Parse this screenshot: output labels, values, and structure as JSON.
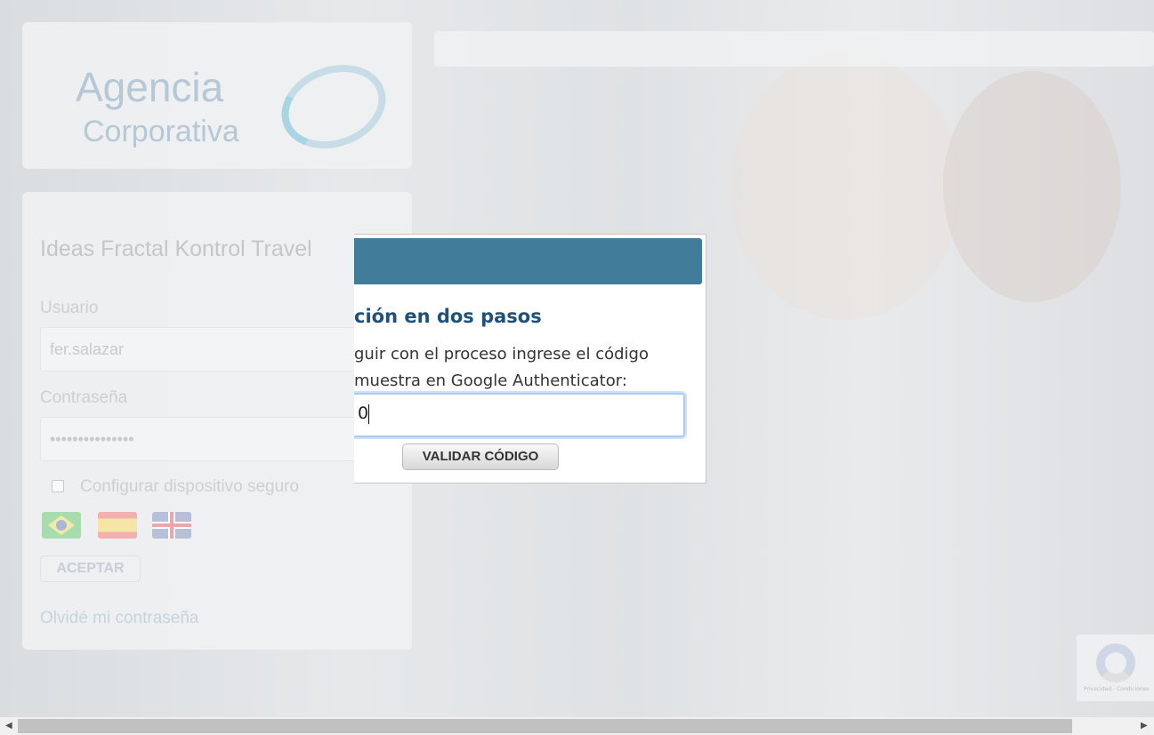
{
  "logo": {
    "line1": "Agencia",
    "line2": "Corporativa"
  },
  "login": {
    "title": "Ideas Fractal Kontrol Travel",
    "user_label": "Usuario",
    "user_value": "fer.salazar",
    "password_label": "Contraseña",
    "password_value": "•••••••••••••••",
    "secure_device_label": "Configurar dispositivo seguro",
    "languages": [
      "Português",
      "Español",
      "English"
    ],
    "accept_label": "ACEPTAR",
    "forgot_label": "Olvidé mi contraseña"
  },
  "modal": {
    "title": "ción en dos pasos",
    "line1": "guir con el proceso ingrese el código",
    "line2": "muestra en Google Authenticator:",
    "code_value": "0",
    "validate_label": "VALIDAR CÓDIGO"
  },
  "recaptcha": {
    "text": "Privacidad - Condiciones"
  }
}
